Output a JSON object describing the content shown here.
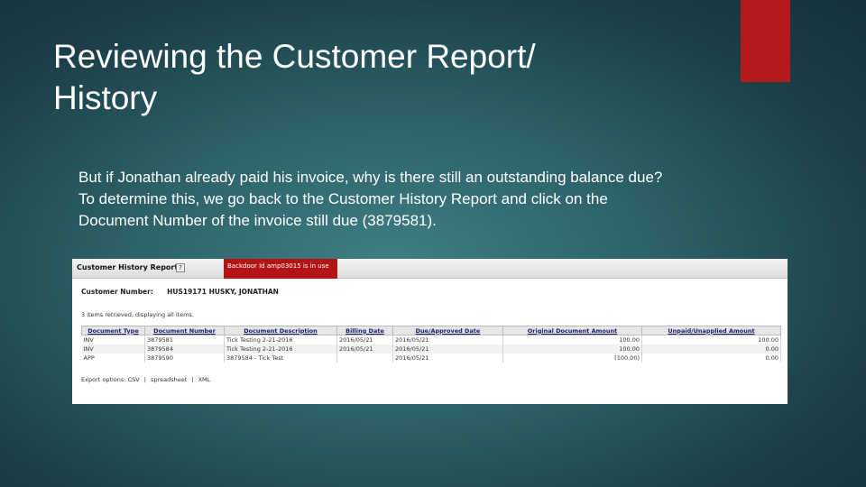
{
  "slide": {
    "title_lines": [
      "Reviewing the Customer Report/",
      "History"
    ],
    "body_lines": [
      "But if Jonathan already paid his invoice, why is there still an outstanding balance due?",
      "To determine this, we go back to the Customer History Report and click on the",
      "Document Number of the invoice still due (3879581)."
    ],
    "accent_color": "#b31a1a"
  },
  "screenshot": {
    "report_title": "Customer History Report",
    "help_icon": "?",
    "notice": "Backdoor Id amp03015 is in use",
    "customer_number_label": "Customer Number:",
    "customer_number": "HUS19171",
    "customer_name": "HUSKY, JONATHAN",
    "retrieved_text": "3 items retrieved, displaying all items.",
    "columns": [
      "Document Type",
      "Document Number",
      "Document Description",
      "Billing Date",
      "Due/Approved Date",
      "Original Document Amount",
      "Unpaid/Unapplied Amount"
    ],
    "rows": [
      [
        "INV",
        "3879581",
        "Tick Testing 2-21-2016",
        "2016/05/21",
        "2016/05/21",
        "100.00",
        "100.00"
      ],
      [
        "INV",
        "3879584",
        "Tick Testing 2-21-2016",
        "2016/05/21",
        "2016/05/21",
        "100.00",
        "0.00"
      ],
      [
        "APP",
        "3879590",
        "3879584 - Tick Test",
        "",
        "2016/05/21",
        "(100.00)",
        "0.00"
      ]
    ],
    "export_label": "Export options:",
    "export_options": [
      "CSV",
      "spreadsheet",
      "XML"
    ]
  }
}
